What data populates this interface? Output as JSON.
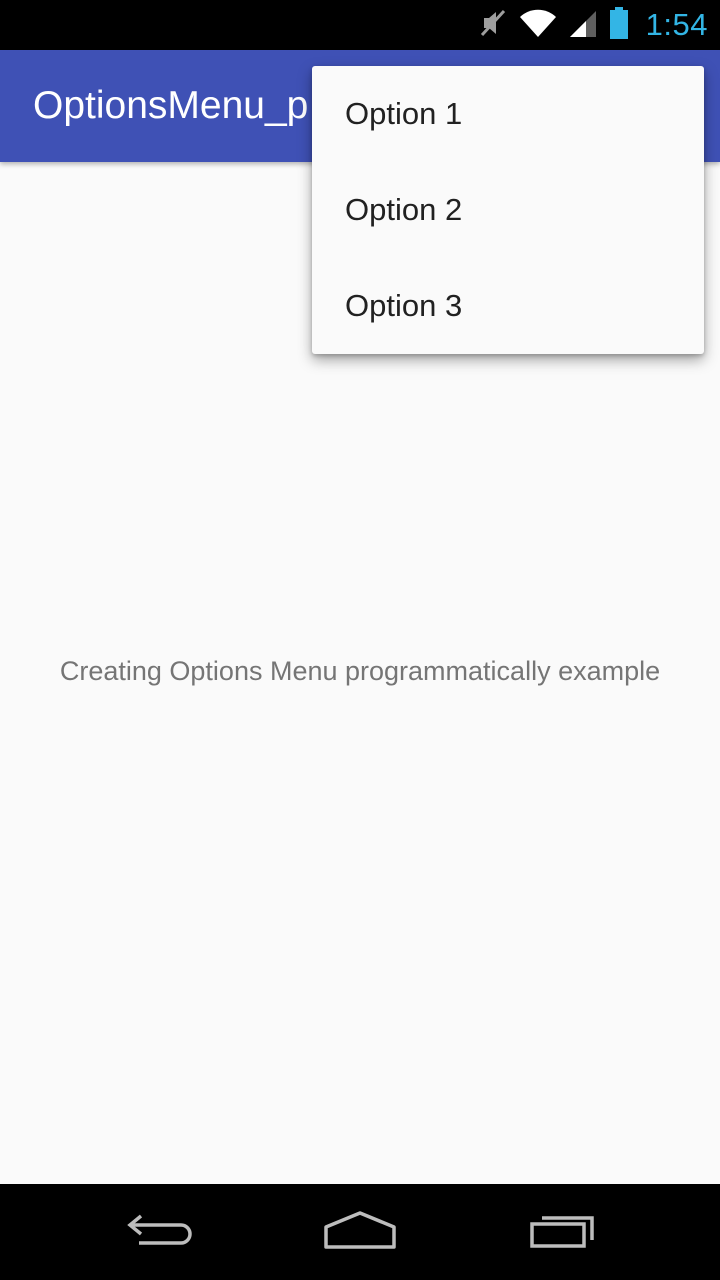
{
  "status_bar": {
    "time": "1:54",
    "icons": [
      "mute-icon",
      "wifi-icon",
      "signal-icon",
      "battery-icon"
    ],
    "accent_color": "#33b5e5"
  },
  "app_bar": {
    "title": "OptionsMenu_p",
    "background_color": "#3f51b5"
  },
  "menu": {
    "items": [
      {
        "label": "Option 1"
      },
      {
        "label": "Option 2"
      },
      {
        "label": "Option 3"
      }
    ]
  },
  "content": {
    "message": "Creating Options Menu programmatically example"
  },
  "nav_bar": {
    "buttons": [
      "back-icon",
      "home-icon",
      "recents-icon"
    ]
  }
}
